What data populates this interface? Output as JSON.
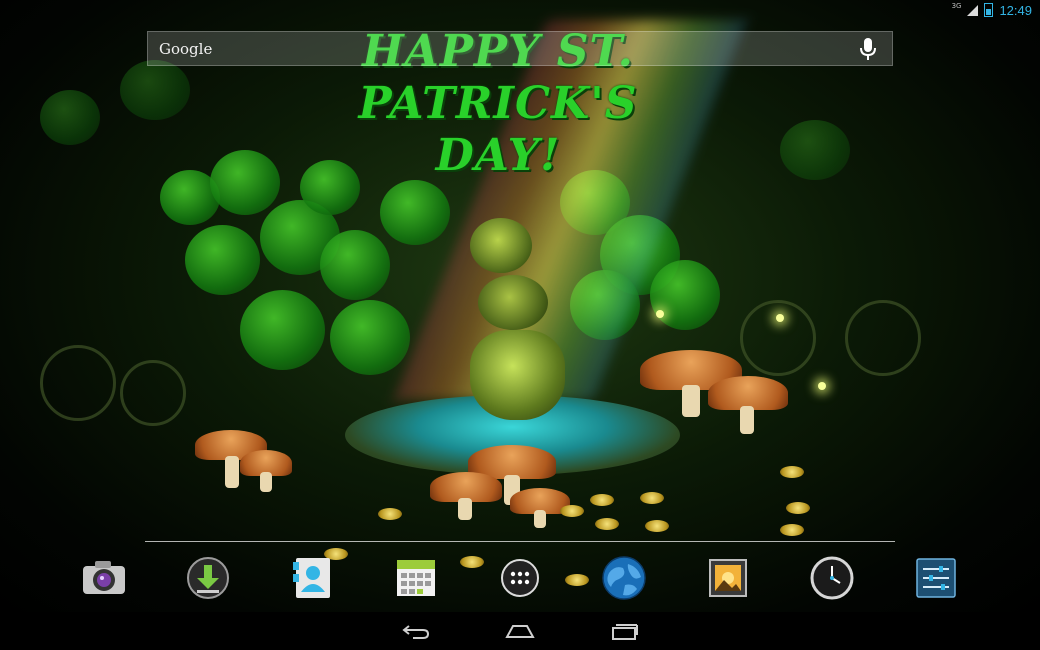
{
  "status_bar": {
    "network": "3G",
    "time": "12:49"
  },
  "search": {
    "label": "Google"
  },
  "wallpaper": {
    "greeting_line1": "HAPPY ST.",
    "greeting_line2": "PATRICK'S DAY!"
  },
  "dock": {
    "items": [
      {
        "icon": "camera-icon"
      },
      {
        "icon": "downloads-icon"
      },
      {
        "icon": "contacts-icon"
      },
      {
        "icon": "calendar-icon"
      },
      {
        "icon": "all-apps-icon"
      },
      {
        "icon": "browser-globe-icon"
      },
      {
        "icon": "gallery-icon"
      },
      {
        "icon": "clock-icon"
      },
      {
        "icon": "settings-icon"
      }
    ]
  },
  "nav_bar": {
    "buttons": [
      "back-icon",
      "home-icon",
      "recent-apps-icon"
    ]
  },
  "colors": {
    "accent": "#33b5e5",
    "greeting": "#29d12a"
  }
}
